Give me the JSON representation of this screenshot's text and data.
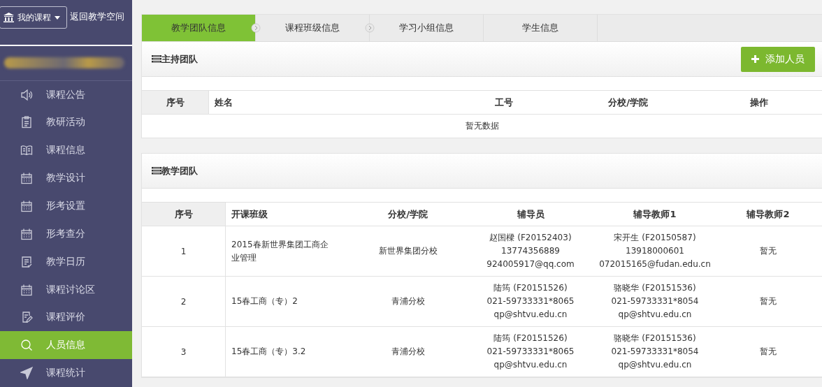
{
  "sidebar": {
    "course_menu": {
      "label": "我的课程"
    },
    "back_link": "返回教学空间",
    "items": [
      {
        "label": "课程公告",
        "kind": "speaker",
        "selected": false
      },
      {
        "label": "教研活动",
        "kind": "clipboard",
        "selected": false
      },
      {
        "label": "课程信息",
        "kind": "book",
        "selected": false
      },
      {
        "label": "教学设计",
        "kind": "calendar",
        "selected": false
      },
      {
        "label": "形考设置",
        "kind": "calendar",
        "selected": false
      },
      {
        "label": "形考查分",
        "kind": "calendar",
        "selected": false
      },
      {
        "label": "教学日历",
        "kind": "list",
        "selected": false
      },
      {
        "label": "课程讨论区",
        "kind": "calendar",
        "selected": false
      },
      {
        "label": "课程评价",
        "kind": "edit",
        "selected": false
      },
      {
        "label": "人员信息",
        "kind": "search",
        "selected": true
      },
      {
        "label": "课程统计",
        "kind": "send",
        "selected": false
      }
    ]
  },
  "tabs": [
    {
      "label": "教学团队信息",
      "selected": true
    },
    {
      "label": "课程班级信息",
      "selected": false
    },
    {
      "label": "学习小组信息",
      "selected": false
    },
    {
      "label": "学生信息",
      "selected": false
    }
  ],
  "host_team": {
    "title": "主持团队",
    "add_button": "添加人员",
    "columns": [
      "序号",
      "姓名",
      "工号",
      "分校/学院",
      "操作"
    ],
    "empty_text": "暂无数据"
  },
  "teaching_team": {
    "title": "教学团队",
    "columns": [
      "序号",
      "开课班级",
      "分校/学院",
      "辅导员",
      "辅导教师1",
      "辅导教师2"
    ],
    "rows": [
      {
        "index": "1",
        "class": "2015春新世界集团工商企业管理",
        "branch": "新世界集团分校",
        "counselor": [
          "赵国樑 (F20152403)",
          "13774356889",
          "924005917@qq.com"
        ],
        "tutor1": [
          "宋开生 (F20150587)",
          "13918000601",
          "072015165@fudan.edu.cn"
        ],
        "tutor2": "暂无"
      },
      {
        "index": "2",
        "class": "15春工商（专）2",
        "branch": "青浦分校",
        "counselor": [
          "陆筠 (F20151526)",
          "021-59733331*8065",
          "qp@shtvu.edu.cn"
        ],
        "tutor1": [
          "骆晓华 (F20151536)",
          "021-59733331*8054",
          "qp@shtvu.edu.cn"
        ],
        "tutor2": "暂无"
      },
      {
        "index": "3",
        "class": "15春工商（专）3.2",
        "branch": "青浦分校",
        "counselor": [
          "陆筠 (F20151526)",
          "021-59733331*8065",
          "qp@shtvu.edu.cn"
        ],
        "tutor1": [
          "骆晓华 (F20151536)",
          "021-59733331*8054",
          "qp@shtvu.edu.cn"
        ],
        "tutor2": "暂无"
      }
    ]
  }
}
